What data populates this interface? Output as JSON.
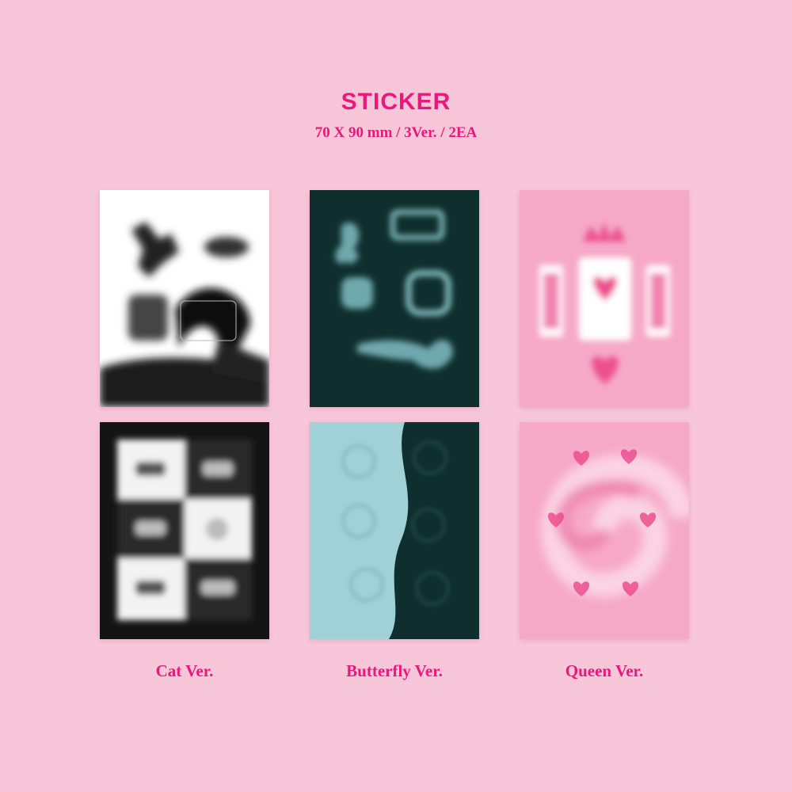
{
  "header": {
    "title": "STICKER",
    "subtitle": "70 X 90 mm / 3Ver. / 2EA"
  },
  "versions": [
    {
      "label": "Cat Ver."
    },
    {
      "label": "Butterfly Ver."
    },
    {
      "label": "Queen Ver."
    }
  ],
  "colors": {
    "background": "#f8c6d9",
    "accent": "#e8197a",
    "butterfly_dark": "#0f2f2e",
    "butterfly_light": "#9fd1d6",
    "queen_pink": "#f6a9c7",
    "queen_hot": "#ec4f8f"
  }
}
